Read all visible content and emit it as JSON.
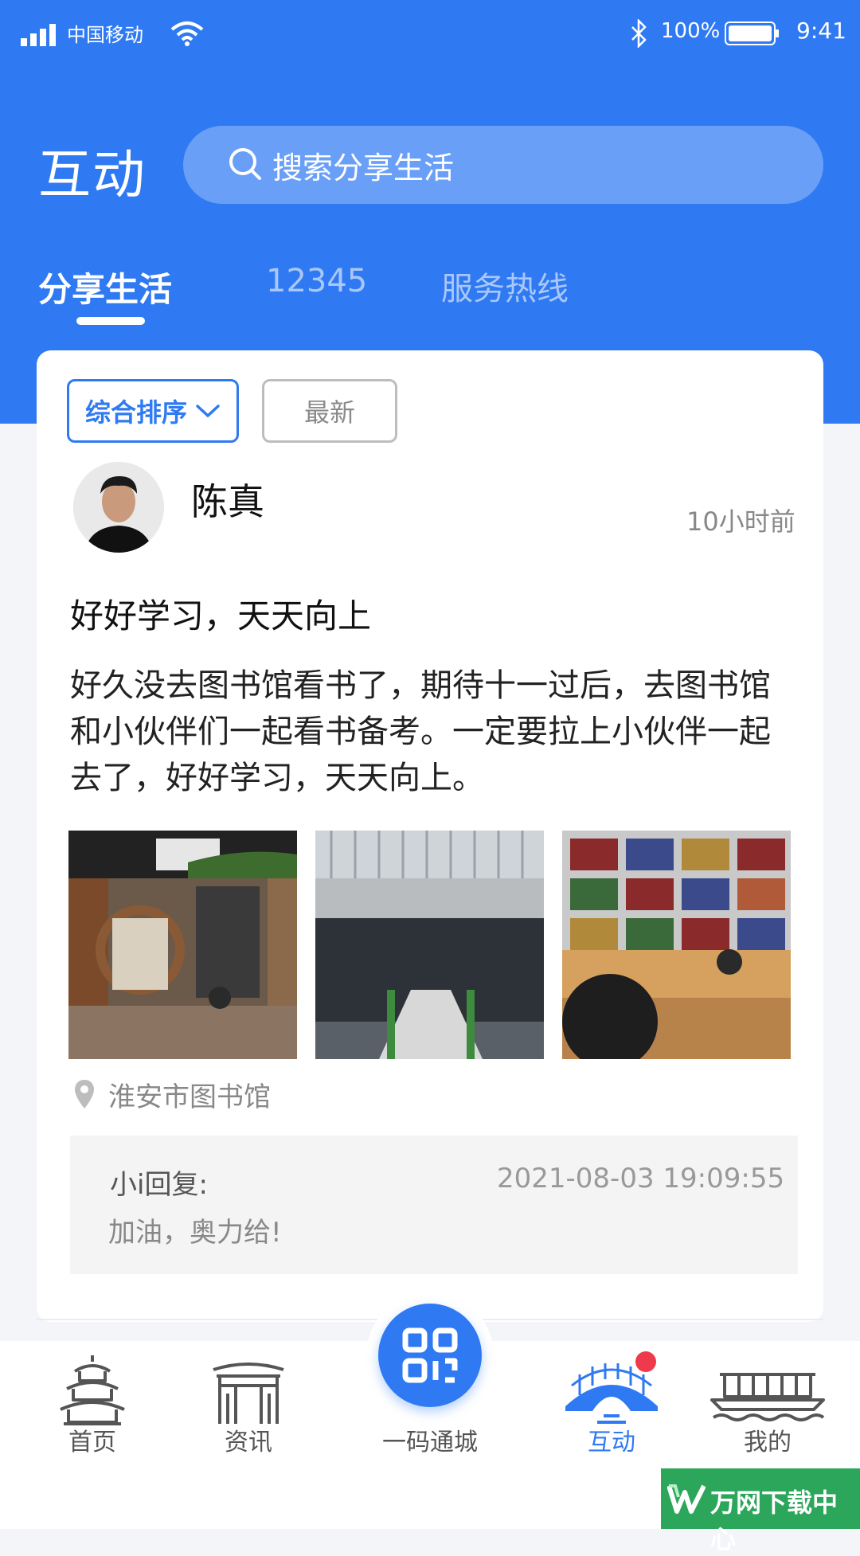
{
  "status_bar": {
    "carrier": "中国移动",
    "battery": "100%",
    "time": "9:41"
  },
  "header": {
    "title": "互动",
    "search_placeholder": "搜索分享生活"
  },
  "tabs": [
    {
      "label": "分享生活",
      "active": true
    },
    {
      "label": "12345",
      "active": false
    },
    {
      "label": "服务热线",
      "active": false
    }
  ],
  "sort": {
    "primary": "综合排序",
    "secondary": "最新"
  },
  "post": {
    "user": "陈真",
    "time": "10小时前",
    "title": "好好学习，天天向上",
    "body": "好久没去图书馆看书了，期待十一过后，去图书馆和小伙伴们一起看书备考。一定要拉上小伙伴一起去了，好好学习，天天向上。",
    "location": "淮安市图书馆",
    "reply": {
      "who": "小i回复:",
      "time": "2021-08-03  19:09:55",
      "text": "加油，奥力给!"
    }
  },
  "bottom_nav": [
    {
      "label": "首页",
      "icon": "pagoda-icon"
    },
    {
      "label": "资讯",
      "icon": "archway-icon"
    },
    {
      "label": "一码通城",
      "icon": "qr-code-icon"
    },
    {
      "label": "互动",
      "icon": "bridge-icon",
      "active": true
    },
    {
      "label": "我的",
      "icon": "boat-icon"
    }
  ],
  "watermark": "万网下载中心",
  "colors": {
    "primary": "#2f7af2",
    "badge": "#ee3a4a",
    "watermark_bg": "#2ca65a"
  }
}
